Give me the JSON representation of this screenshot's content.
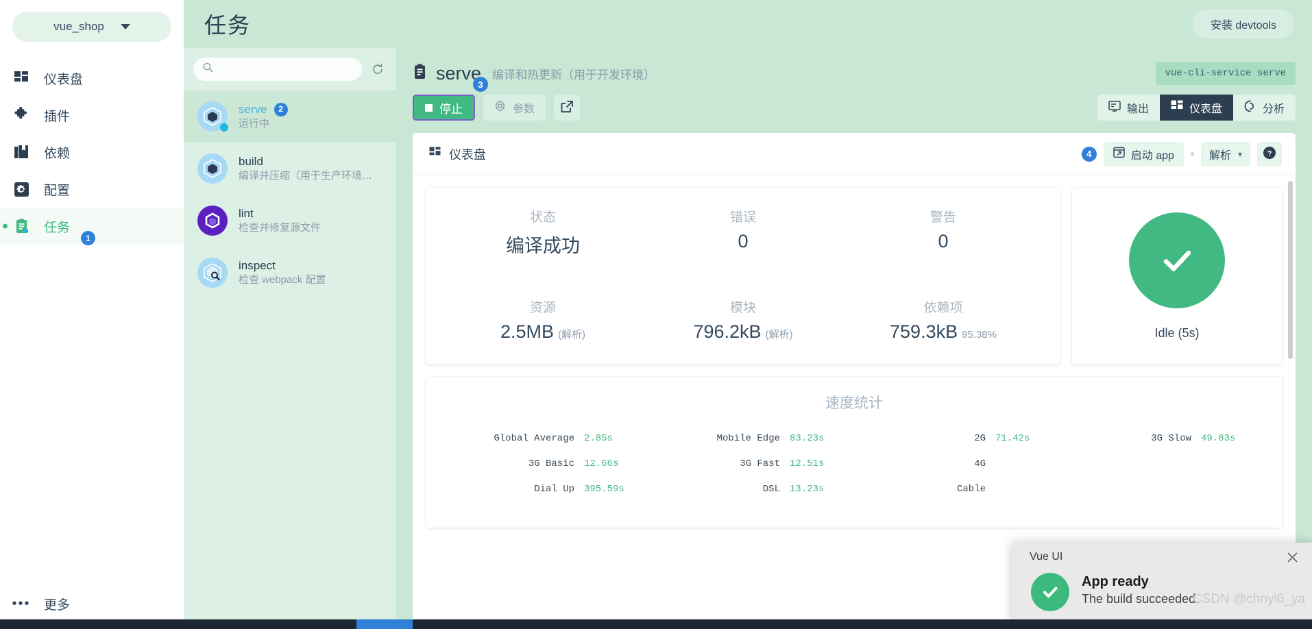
{
  "sidebar": {
    "project": {
      "name": "vue_shop",
      "icon": "chevron-down-icon"
    },
    "items": [
      {
        "label": "仪表盘",
        "icon": "dashboard-icon",
        "active": false,
        "badge": null
      },
      {
        "label": "插件",
        "icon": "puzzle-icon",
        "active": false,
        "badge": null
      },
      {
        "label": "依赖",
        "icon": "book-icon",
        "active": false,
        "badge": null
      },
      {
        "label": "配置",
        "icon": "gear-icon",
        "active": false,
        "badge": null
      },
      {
        "label": "任务",
        "icon": "clipboard-icon",
        "active": true,
        "badge": "1"
      }
    ],
    "footer": {
      "label": "更多",
      "icon": "dots-icon"
    }
  },
  "topbar": {
    "title": "任务",
    "devtools_button": "安装 devtools"
  },
  "task_list": {
    "search_placeholder": "",
    "search_value": "",
    "refresh_icon": "refresh-icon",
    "tasks": [
      {
        "name": "serve",
        "desc": "运行中",
        "icon": "webpack-icon",
        "badge": "2",
        "selected": true,
        "running": true
      },
      {
        "name": "build",
        "desc": "编译并压缩（用于生产环境…",
        "icon": "webpack-icon",
        "badge": null,
        "selected": false,
        "running": false
      },
      {
        "name": "lint",
        "desc": "检查并修复源文件",
        "icon": "eslint-icon",
        "badge": null,
        "selected": false,
        "running": false
      },
      {
        "name": "inspect",
        "desc": "检查 webpack 配置",
        "icon": "webpack-inspect-icon",
        "badge": null,
        "selected": false,
        "running": false
      }
    ]
  },
  "detail": {
    "title": "serve",
    "subtitle": "编译和热更新（用于开发环境）",
    "command": "vue-cli-service serve",
    "badge_3": "3",
    "buttons": {
      "stop": "停止",
      "params": "参数",
      "open_external_icon": "external-link-icon"
    },
    "view_tabs": [
      {
        "label": "输出",
        "icon": "terminal-icon",
        "active": false
      },
      {
        "label": "仪表盘",
        "icon": "dashboard-icon",
        "active": true
      },
      {
        "label": "分析",
        "icon": "analyze-icon",
        "active": false
      }
    ]
  },
  "panel": {
    "toolbar": {
      "title": "仪表盘",
      "title_icon": "dashboard-icon",
      "badge_4": "4",
      "launch_app": "启动 app",
      "launch_icon": "open-app-icon",
      "parse_select": "解析",
      "help_icon": "help-icon"
    },
    "stats": {
      "row1": [
        {
          "label": "状态",
          "value": "编译成功",
          "suffix": ""
        },
        {
          "label": "错误",
          "value": "0",
          "suffix": ""
        },
        {
          "label": "警告",
          "value": "0",
          "suffix": ""
        }
      ],
      "row2": [
        {
          "label": "资源",
          "value": "2.5MB",
          "suffix": "(解析)"
        },
        {
          "label": "模块",
          "value": "796.2kB",
          "suffix": "(解析)"
        },
        {
          "label": "依赖项",
          "value": "759.3kB",
          "suffix": "95.38%"
        }
      ]
    },
    "status_card": {
      "icon": "check-circle-icon",
      "text": "Idle (5s)",
      "color": "#42b983"
    },
    "speed": {
      "title": "速度统计",
      "entries": [
        {
          "key": "Global Average",
          "value": "2.85s"
        },
        {
          "key": "Mobile Edge",
          "value": "83.23s"
        },
        {
          "key": "2G",
          "value": "71.42s"
        },
        {
          "key": "3G Slow",
          "value": "49.83s"
        },
        {
          "key": "3G Basic",
          "value": "12.66s"
        },
        {
          "key": "3G Fast",
          "value": "12.51s"
        },
        {
          "key": "4G",
          "value": ""
        },
        {
          "key": "",
          "value": ""
        },
        {
          "key": "Dial Up",
          "value": "395.59s"
        },
        {
          "key": "DSL",
          "value": "13.23s"
        },
        {
          "key": "Cable",
          "value": ""
        },
        {
          "key": "",
          "value": ""
        }
      ]
    }
  },
  "toast": {
    "app": "Vue UI",
    "title": "App ready",
    "message": "The build succeeded.",
    "close_icon": "close-icon",
    "icon": "check-circle-icon"
  },
  "watermark": "CSDN @chnyi6_ya",
  "colors": {
    "accent_green": "#42b983",
    "badge_blue": "#2f80d8",
    "dark_navy": "#2c3e50",
    "muted": "#8c9bab"
  }
}
